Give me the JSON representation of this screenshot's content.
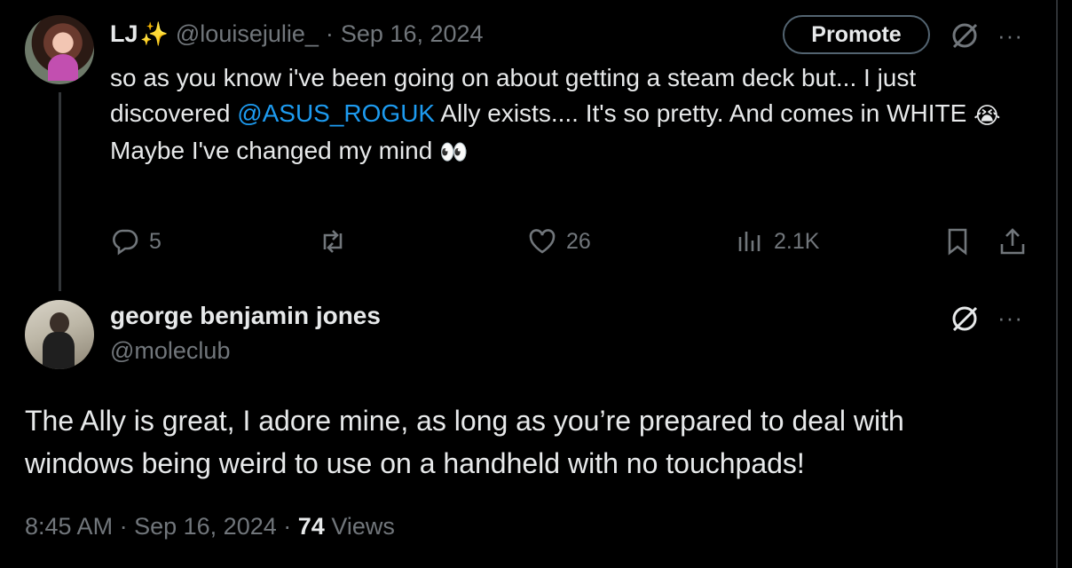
{
  "tweet1": {
    "name": "LJ",
    "name_emoji": "✨",
    "handle": "@louisejulie_",
    "separator": "·",
    "date": "Sep 16, 2024",
    "promote_label": "Promote",
    "more_label": "···",
    "text_part1": "so as you know i've been going on about getting a steam deck but... I just discovered ",
    "mention": "@ASUS_ROGUK",
    "text_part2": " Ally exists.... It's so pretty. And comes in WHITE ",
    "emoji_cry": "😭",
    "text_line2": "Maybe I've changed my mind ",
    "emoji_eyes": "👀",
    "replies": "5",
    "likes": "26",
    "views": "2.1K"
  },
  "tweet2": {
    "name": "george benjamin jones",
    "handle": "@moleclub",
    "more_label": "···",
    "text": "The Ally is great, I adore mine, as long as you’re prepared to deal with windows being weird to use on a handheld with no touchpads!",
    "time": "8:45 AM",
    "separator": "·",
    "date": "Sep 16, 2024",
    "views_count": "74",
    "views_label": "Views"
  },
  "colors": {
    "accent": "#1d9bf0",
    "muted": "#71767b",
    "text": "#e7e9ea",
    "background": "#000000"
  },
  "icons": [
    "reply-icon",
    "retweet-icon",
    "like-icon",
    "views-icon",
    "bookmark-icon",
    "share-icon",
    "grok-icon",
    "more-icon"
  ]
}
